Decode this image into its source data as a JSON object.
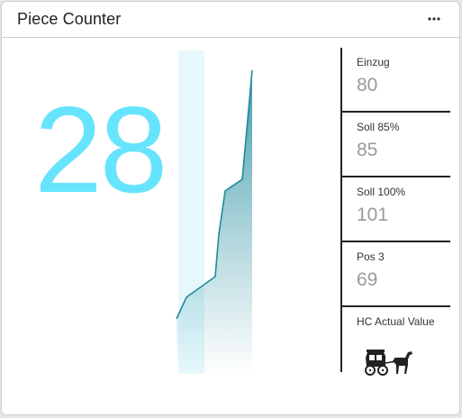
{
  "widget": {
    "title": "Piece Counter",
    "menu_icon": "more-horizontal-icon",
    "value": "28",
    "value_color": "#66e4fd"
  },
  "sparkline": {
    "line_color": "#1f8a9c",
    "highlight_color": "#e6f8fd"
  },
  "kpis": [
    {
      "label": "Einzug",
      "value": "80"
    },
    {
      "label": "Soll 85%",
      "value": "85"
    },
    {
      "label": "Soll 100%",
      "value": "101"
    },
    {
      "label": "Pos 3",
      "value": "69"
    }
  ],
  "hc": {
    "label": "HC Actual Value",
    "icon": "horse-carriage-icon"
  }
}
